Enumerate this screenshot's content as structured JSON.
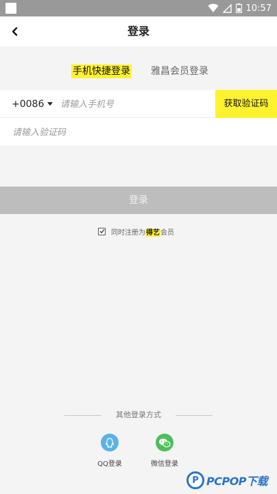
{
  "status_bar": {
    "time": "10:57"
  },
  "header": {
    "title": "登录"
  },
  "tabs": [
    {
      "label": "手机快捷登录",
      "active": true
    },
    {
      "label": "雅昌会员登录",
      "active": false
    }
  ],
  "phone_form": {
    "country_code": "+0086",
    "phone_placeholder": "请输入手机号",
    "get_code_label": "获取验证码",
    "code_placeholder": "请输入验证码"
  },
  "login_button": {
    "label": "登录"
  },
  "agreement": {
    "prefix": "同时注册为",
    "brand": "得艺",
    "suffix": "会员",
    "checked": true
  },
  "other_login": {
    "label": "其他登录方式",
    "options": [
      {
        "label": "QQ登录",
        "icon": "qq-icon"
      },
      {
        "label": "微信登录",
        "icon": "wechat-icon"
      }
    ]
  },
  "watermark": {
    "text": "PCPOP下载"
  },
  "colors": {
    "accent_yellow": "#fff22e",
    "qq_blue": "#5ab2e6",
    "wechat_green": "#4cbf5a",
    "disabled_button": "#bdbdbd"
  }
}
